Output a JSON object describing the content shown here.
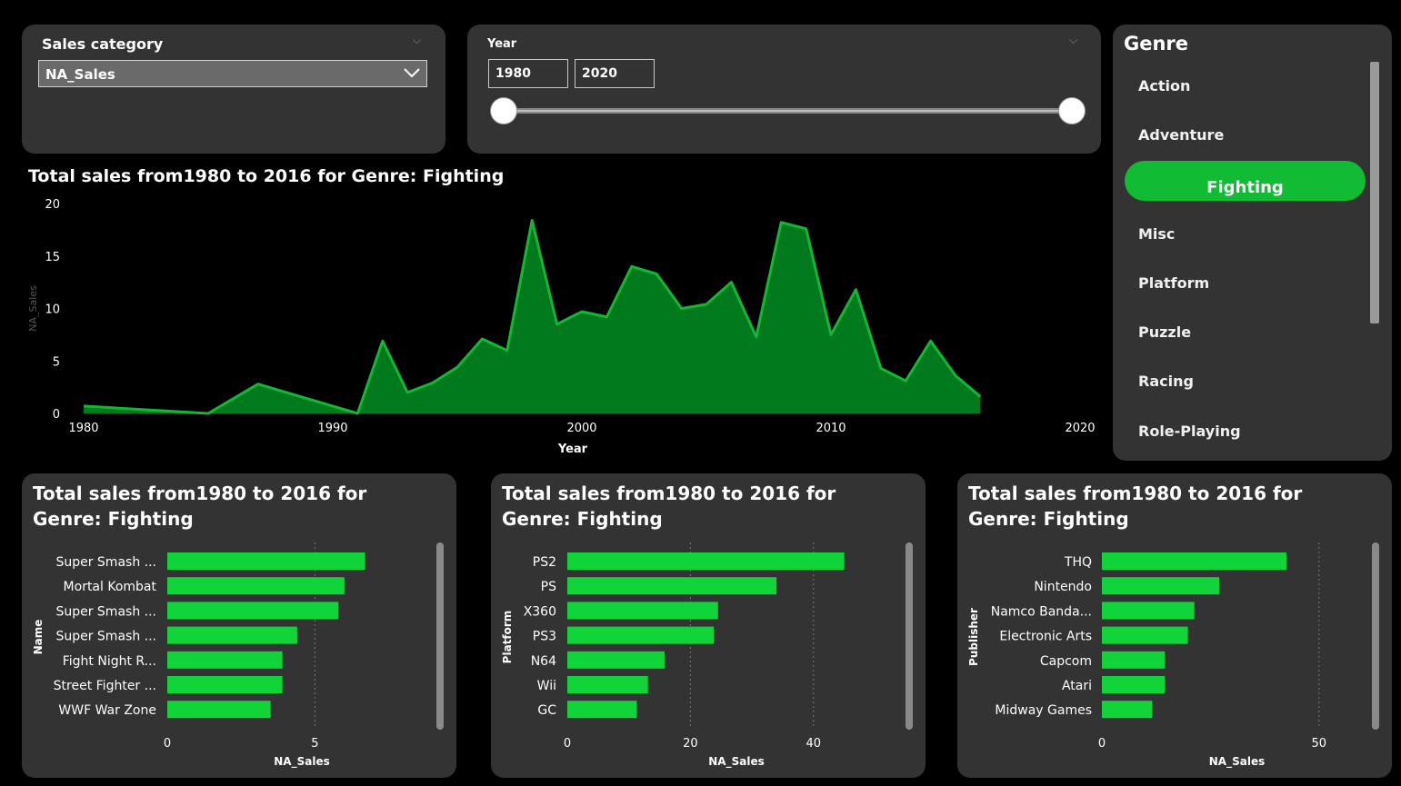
{
  "sales_slicer": {
    "title": "Sales category",
    "selected": "NA_Sales"
  },
  "year_slicer": {
    "title": "Year",
    "start": "1980",
    "end": "2020"
  },
  "genre_slicer": {
    "title": "Genre",
    "items": [
      "Action",
      "Adventure",
      "Fighting",
      "Misc",
      "Platform",
      "Puzzle",
      "Racing",
      "Role-Playing"
    ],
    "selected": "Fighting"
  },
  "colors": {
    "accent": "#11bb33",
    "area_fill": "#007a1c",
    "area_line": "#13b733",
    "bar": "#10d43a",
    "card": "#333333"
  },
  "chart_data": [
    {
      "type": "area",
      "title": "Total sales from1980 to 2016 for Genre: Fighting",
      "xlabel": "Year",
      "ylabel": "NA_Sales",
      "xlim": [
        1980,
        2020
      ],
      "ylim": [
        0,
        20
      ],
      "xticks": [
        "1980",
        "1990",
        "2000",
        "2010",
        "2020"
      ],
      "yticks": [
        "0",
        "5",
        "10",
        "15",
        "20"
      ],
      "x": [
        1980,
        1985,
        1987,
        1991,
        1992,
        1993,
        1994,
        1995,
        1996,
        1997,
        1998,
        1999,
        2000,
        2001,
        2002,
        2003,
        2004,
        2005,
        2006,
        2007,
        2008,
        2009,
        2010,
        2011,
        2012,
        2013,
        2014,
        2015,
        2016
      ],
      "values": [
        0.7,
        0.0,
        2.8,
        0.0,
        6.9,
        2.0,
        2.9,
        4.4,
        7.1,
        6.0,
        18.4,
        8.5,
        9.7,
        9.2,
        14.0,
        13.3,
        10.0,
        10.4,
        12.5,
        7.3,
        18.2,
        17.6,
        7.5,
        11.8,
        4.3,
        3.1,
        6.9,
        3.6,
        1.6
      ],
      "grid": false
    },
    {
      "type": "bar",
      "title": "Total sales from1980 to 2016 for Genre: Fighting",
      "ylabel": "Name",
      "xlabel": "NA_Sales",
      "categories": [
        "Super Smash ...",
        "Mortal Kombat",
        "Super Smash ...",
        "Super Smash ...",
        "Fight Night R...",
        "Street Fighter ...",
        "WWF War Zone"
      ],
      "values": [
        6.7,
        6.0,
        5.8,
        4.4,
        3.9,
        3.9,
        3.5
      ],
      "xlim": [
        0,
        8.5
      ],
      "xticks": [
        0,
        5
      ]
    },
    {
      "type": "bar",
      "title": "Total sales from1980 to 2016 for Genre: Fighting",
      "ylabel": "Platform",
      "xlabel": "NA_Sales",
      "categories": [
        "PS2",
        "PS",
        "X360",
        "PS3",
        "N64",
        "Wii",
        "GC"
      ],
      "values": [
        45.0,
        34.0,
        24.5,
        23.8,
        15.8,
        13.1,
        11.3
      ],
      "xlim": [
        0,
        52
      ],
      "xticks": [
        0,
        20,
        40
      ]
    },
    {
      "type": "bar",
      "title": "Total sales from1980 to 2016 for Genre: Fighting",
      "ylabel": "Publisher",
      "xlabel": "NA_Sales",
      "categories": [
        "THQ",
        "Nintendo",
        "Namco Banda...",
        "Electronic Arts",
        "Capcom",
        "Atari",
        "Midway Games"
      ],
      "values": [
        42.5,
        27.0,
        21.3,
        19.8,
        14.5,
        14.5,
        11.6
      ],
      "xlim": [
        0,
        58
      ],
      "xticks": [
        0,
        50
      ]
    }
  ]
}
